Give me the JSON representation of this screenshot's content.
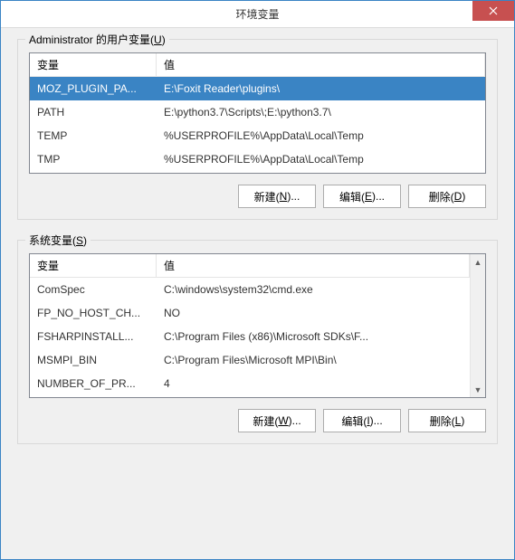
{
  "window": {
    "title": "环境变量"
  },
  "user_section": {
    "title_prefix": "Administrator 的用户变量(",
    "title_key": "U",
    "title_suffix": ")",
    "header_var": "变量",
    "header_val": "值",
    "rows": [
      {
        "var": "MOZ_PLUGIN_PA...",
        "val": "E:\\Foxit Reader\\plugins\\",
        "selected": true
      },
      {
        "var": "PATH",
        "val": "E:\\python3.7\\Scripts\\;E:\\python3.7\\",
        "selected": false
      },
      {
        "var": "TEMP",
        "val": "%USERPROFILE%\\AppData\\Local\\Temp",
        "selected": false
      },
      {
        "var": "TMP",
        "val": "%USERPROFILE%\\AppData\\Local\\Temp",
        "selected": false
      }
    ],
    "btn_new_pre": "新建(",
    "btn_new_key": "N",
    "btn_new_post": ")...",
    "btn_edit_pre": "编辑(",
    "btn_edit_key": "E",
    "btn_edit_post": ")...",
    "btn_del_pre": "删除(",
    "btn_del_key": "D",
    "btn_del_post": ")"
  },
  "sys_section": {
    "title_prefix": "系统变量(",
    "title_key": "S",
    "title_suffix": ")",
    "header_var": "变量",
    "header_val": "值",
    "rows": [
      {
        "var": "ComSpec",
        "val": "C:\\windows\\system32\\cmd.exe"
      },
      {
        "var": "FP_NO_HOST_CH...",
        "val": "NO"
      },
      {
        "var": "FSHARPINSTALL...",
        "val": "C:\\Program Files (x86)\\Microsoft SDKs\\F..."
      },
      {
        "var": "MSMPI_BIN",
        "val": "C:\\Program Files\\Microsoft MPI\\Bin\\"
      },
      {
        "var": "NUMBER_OF_PR...",
        "val": "4"
      }
    ],
    "btn_new_pre": "新建(",
    "btn_new_key": "W",
    "btn_new_post": ")...",
    "btn_edit_pre": "编辑(",
    "btn_edit_key": "I",
    "btn_edit_post": ")...",
    "btn_del_pre": "删除(",
    "btn_del_key": "L",
    "btn_del_post": ")"
  }
}
